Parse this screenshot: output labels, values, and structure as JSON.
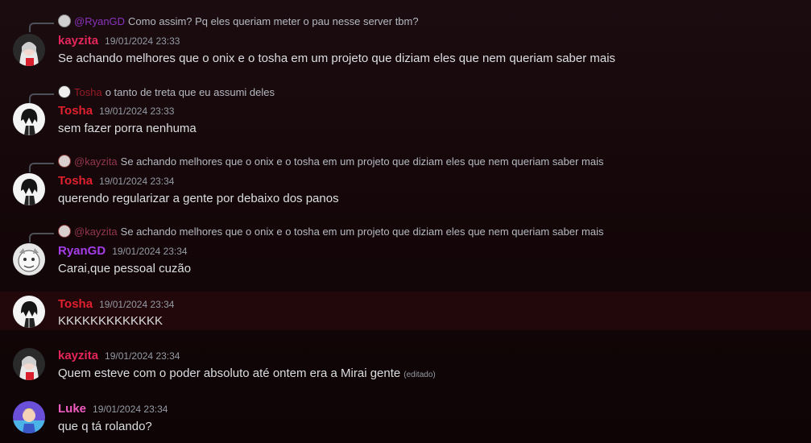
{
  "colors": {
    "kayzita": "#e5265a",
    "tosha": "#e0202e",
    "ryangd": "#a53de8",
    "luke": "#ef5cc0"
  },
  "messages": [
    {
      "reply": {
        "author": "@RyanGD",
        "text": "Como assim? Pq eles queriam meter o pau nesse server tbm?"
      },
      "author": "kayzita",
      "timestamp": "19/01/2024 23:33",
      "content": "Se achando melhores que o onix e o tosha em um projeto que diziam eles que nem queriam saber mais"
    },
    {
      "reply": {
        "author": "Tosha",
        "text": "o tanto de treta que eu assumi deles"
      },
      "author": "Tosha",
      "timestamp": "19/01/2024 23:33",
      "content": "sem fazer porra nenhuma"
    },
    {
      "reply": {
        "author": "@kayzita",
        "text": "Se achando melhores que o onix e o tosha em um projeto que diziam eles que nem queriam saber mais"
      },
      "author": "Tosha",
      "timestamp": "19/01/2024 23:34",
      "content": "querendo regularizar a gente por debaixo dos panos"
    },
    {
      "reply": {
        "author": "@kayzita",
        "text": "Se achando melhores que o onix e o tosha em um projeto que diziam eles que nem queriam saber mais"
      },
      "author": "RyanGD",
      "timestamp": "19/01/2024 23:34",
      "content": "Carai,que pessoal cuzão"
    },
    {
      "author": "Tosha",
      "timestamp": "19/01/2024 23:34",
      "content": "KKKKKKKKKKKKK"
    },
    {
      "author": "kayzita",
      "timestamp": "19/01/2024 23:34",
      "content": "Quem esteve com o poder absoluto até ontem era a Mirai gente",
      "edited": "(editado)"
    },
    {
      "author": "Luke",
      "timestamp": "19/01/2024 23:34",
      "content": "que q tá rolando?"
    }
  ]
}
